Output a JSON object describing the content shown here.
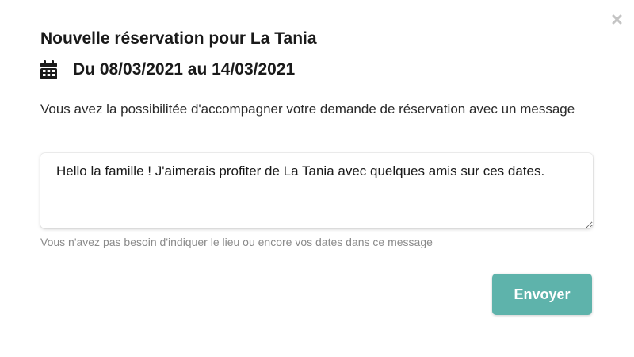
{
  "modal": {
    "title": "Nouvelle réservation pour La Tania",
    "dates": "Du 08/03/2021 au 14/03/2021",
    "intro": "Vous avez la possibilitée d'accompagner votre demande de réservation avec un message",
    "message_value": "Hello la famille ! J'aimerais profiter de La Tania avec quelques amis sur ces dates.",
    "help": "Vous n'avez pas besoin d'indiquer le lieu ou encore vos dates dans ce message",
    "send_label": "Envoyer"
  },
  "icons": {
    "close": "close-icon",
    "calendar": "calendar-icon"
  },
  "colors": {
    "accent": "#5eb3ab",
    "help_text": "#8a8a8a",
    "close_icon": "#c4c4c4"
  }
}
